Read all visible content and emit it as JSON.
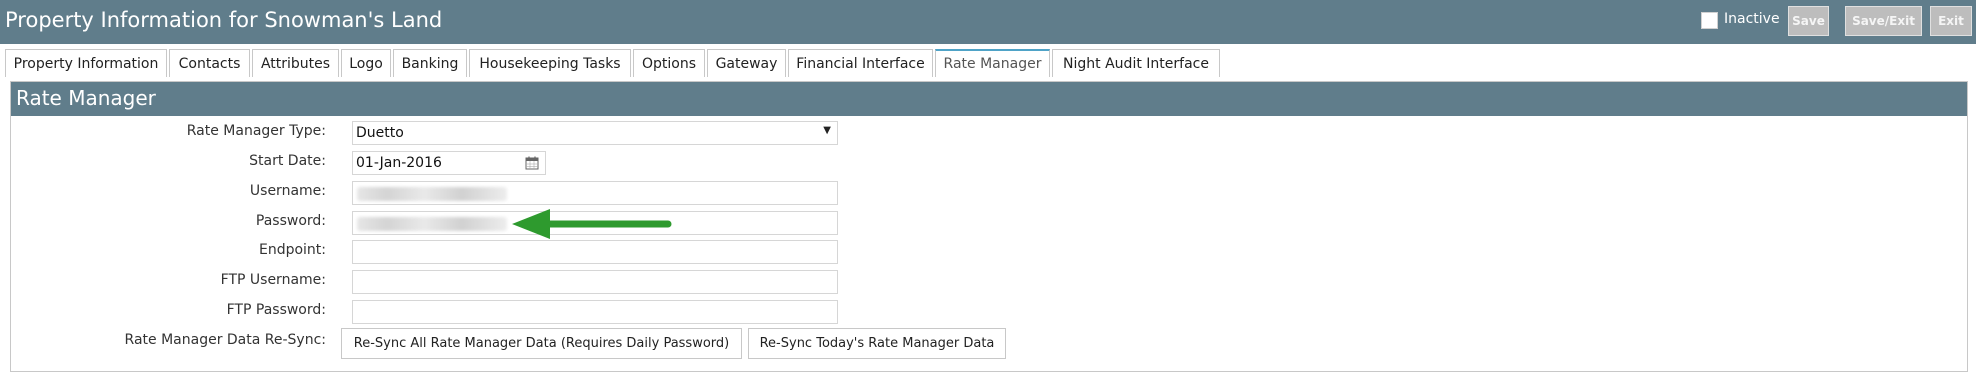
{
  "window": {
    "title": "Property Information for Snowman's Land",
    "inactive_label": "Inactive",
    "inactive_checked": false,
    "buttons": {
      "save": "Save",
      "save_exit": "Save/Exit",
      "exit": "Exit"
    }
  },
  "tabs": [
    {
      "label": "Property Information",
      "active": false
    },
    {
      "label": "Contacts",
      "active": false
    },
    {
      "label": "Attributes",
      "active": false
    },
    {
      "label": "Logo",
      "active": false
    },
    {
      "label": "Banking",
      "active": false
    },
    {
      "label": "Housekeeping Tasks",
      "active": false
    },
    {
      "label": "Options",
      "active": false
    },
    {
      "label": "Gateway",
      "active": false
    },
    {
      "label": "Financial Interface",
      "active": false
    },
    {
      "label": "Rate Manager",
      "active": true
    },
    {
      "label": "Night Audit Interface",
      "active": false
    }
  ],
  "rate_manager": {
    "title": "Rate Manager",
    "fields": {
      "type": {
        "label": "Rate Manager Type:",
        "value": "Duetto"
      },
      "start_date": {
        "label": "Start Date:",
        "value": "01-Jan-2016"
      },
      "username": {
        "label": "Username:",
        "value": ""
      },
      "password": {
        "label": "Password:",
        "value": ""
      },
      "endpoint": {
        "label": "Endpoint:",
        "value": ""
      },
      "ftp_username": {
        "label": "FTP Username:",
        "value": ""
      },
      "ftp_password": {
        "label": "FTP Password:",
        "value": ""
      }
    },
    "resync": {
      "label": "Rate Manager Data Re-Sync:",
      "all_button": "Re-Sync All Rate Manager Data (Requires Daily Password)",
      "today_button": "Re-Sync Today's Rate Manager Data"
    }
  },
  "colors": {
    "header": "#607d8b",
    "arrow": "#2e9a2e",
    "active_tab_accent": "#4fa3c7"
  }
}
